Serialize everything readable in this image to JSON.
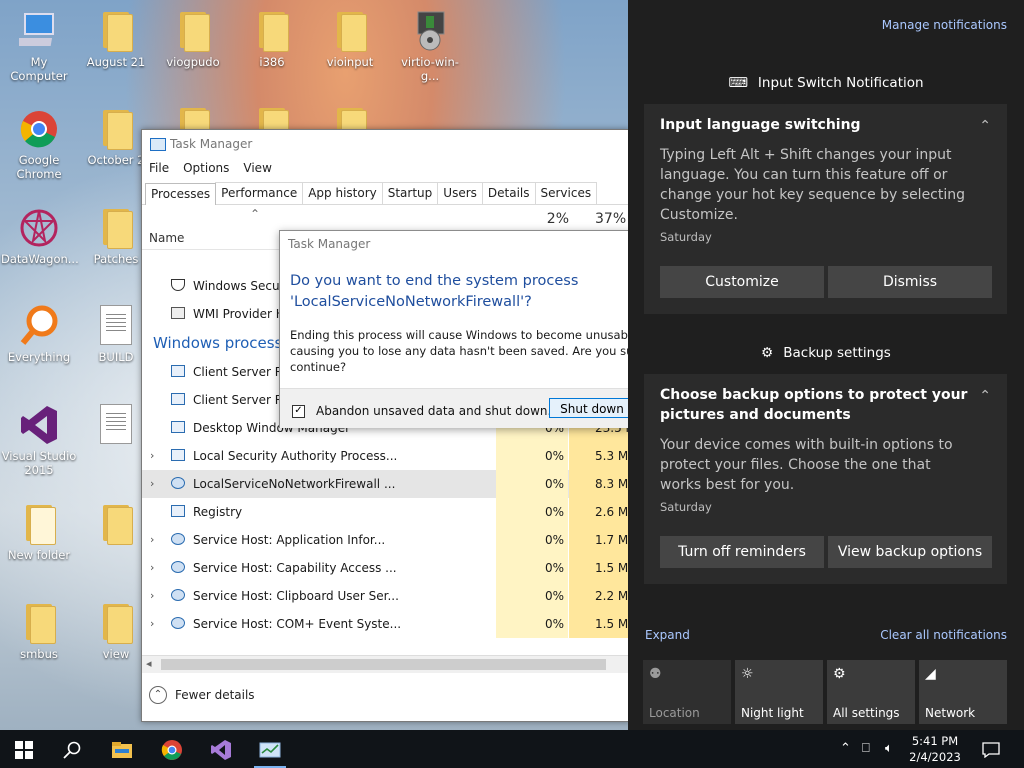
{
  "desktop": {
    "icons": [
      {
        "label": "My Computer"
      },
      {
        "label": "August 21"
      },
      {
        "label": "viogpudo"
      },
      {
        "label": "i386"
      },
      {
        "label": "vioinput"
      },
      {
        "label": "virtio-win-g..."
      },
      {
        "label": "Google Chrome"
      },
      {
        "label": "October 2"
      },
      {
        "label": "DataWagon..."
      },
      {
        "label": "Patches"
      },
      {
        "label": "Everything"
      },
      {
        "label": "BUILD"
      },
      {
        "label": "Visual Studio 2015"
      },
      {
        "label": "New folder"
      },
      {
        "label": "smbus"
      },
      {
        "label": "view"
      }
    ]
  },
  "task_manager": {
    "title": "Task Manager",
    "menu": [
      "File",
      "Options",
      "View"
    ],
    "tabs": [
      "Processes",
      "Performance",
      "App history",
      "Startup",
      "Users",
      "Details",
      "Services"
    ],
    "active_tab": "Processes",
    "column_name": "Name",
    "cpu_header": "2%",
    "mem_header": "37%",
    "pre_rows": [
      {
        "name": "Windows Securit"
      },
      {
        "name": "WMI Provider Ho"
      }
    ],
    "group_label": "Windows processes",
    "rows": [
      {
        "name": "Client Server Run",
        "cpu": "",
        "mem": "",
        "expandable": false
      },
      {
        "name": "Client Server Run",
        "cpu": "",
        "mem": "",
        "expandable": false
      },
      {
        "name": "Desktop Window Manager",
        "cpu": "0%",
        "mem": "23.5 M",
        "expandable": false
      },
      {
        "name": "Local Security Authority Process...",
        "cpu": "0%",
        "mem": "5.3 M",
        "expandable": true
      },
      {
        "name": "LocalServiceNoNetworkFirewall ...",
        "cpu": "0%",
        "mem": "8.3 M",
        "expandable": true,
        "selected": true
      },
      {
        "name": "Registry",
        "cpu": "0%",
        "mem": "2.6 M",
        "expandable": false
      },
      {
        "name": "Service Host: Application Infor...",
        "cpu": "0%",
        "mem": "1.7 M",
        "expandable": true
      },
      {
        "name": "Service Host: Capability Access ...",
        "cpu": "0%",
        "mem": "1.5 M",
        "expandable": true
      },
      {
        "name": "Service Host: Clipboard User Ser...",
        "cpu": "0%",
        "mem": "2.2 M",
        "expandable": true
      },
      {
        "name": "Service Host: COM+ Event Syste...",
        "cpu": "0%",
        "mem": "1.5 M",
        "expandable": true
      }
    ],
    "fewer_details": "Fewer details"
  },
  "dialog": {
    "title": "Task Manager",
    "heading_line1": "Do you want to end the system process",
    "heading_line2": "'LocalServiceNoNetworkFirewall'?",
    "body_line1": "Ending this process will cause Windows to become unusable or s",
    "body_line2": "causing you to lose any data hasn't been saved. Are you sure you",
    "body_line3": "continue?",
    "checkbox_label": "Abandon unsaved data and shut down.",
    "checkbox_checked": true,
    "button": "Shut down"
  },
  "action_center": {
    "manage": "Manage notifications",
    "group1_title": "Input Switch Notification",
    "card1": {
      "title": "Input language switching",
      "body": "Typing Left Alt + Shift changes your input language. You can turn this feature off or change your hot key sequence by selecting Customize.",
      "when": "Saturday",
      "btn1": "Customize",
      "btn2": "Dismiss"
    },
    "group2_title": "Backup settings",
    "card2": {
      "title": "Choose backup options to protect your pictures and documents",
      "body": "Your device comes with built-in options to protect your files. Choose the one that works best for you.",
      "when": "Saturday",
      "btn1": "Turn off reminders",
      "btn2": "View backup options"
    },
    "expand": "Expand",
    "clear": "Clear all notifications",
    "quick_actions": [
      {
        "label": "Location",
        "icon": "location-icon",
        "enabled": false
      },
      {
        "label": "Night light",
        "icon": "night-light-icon",
        "enabled": true
      },
      {
        "label": "All settings",
        "icon": "gear-icon",
        "enabled": true
      },
      {
        "label": "Network",
        "icon": "network-icon",
        "enabled": true
      }
    ]
  },
  "taskbar": {
    "time": "5:41 PM",
    "date": "2/4/2023"
  }
}
